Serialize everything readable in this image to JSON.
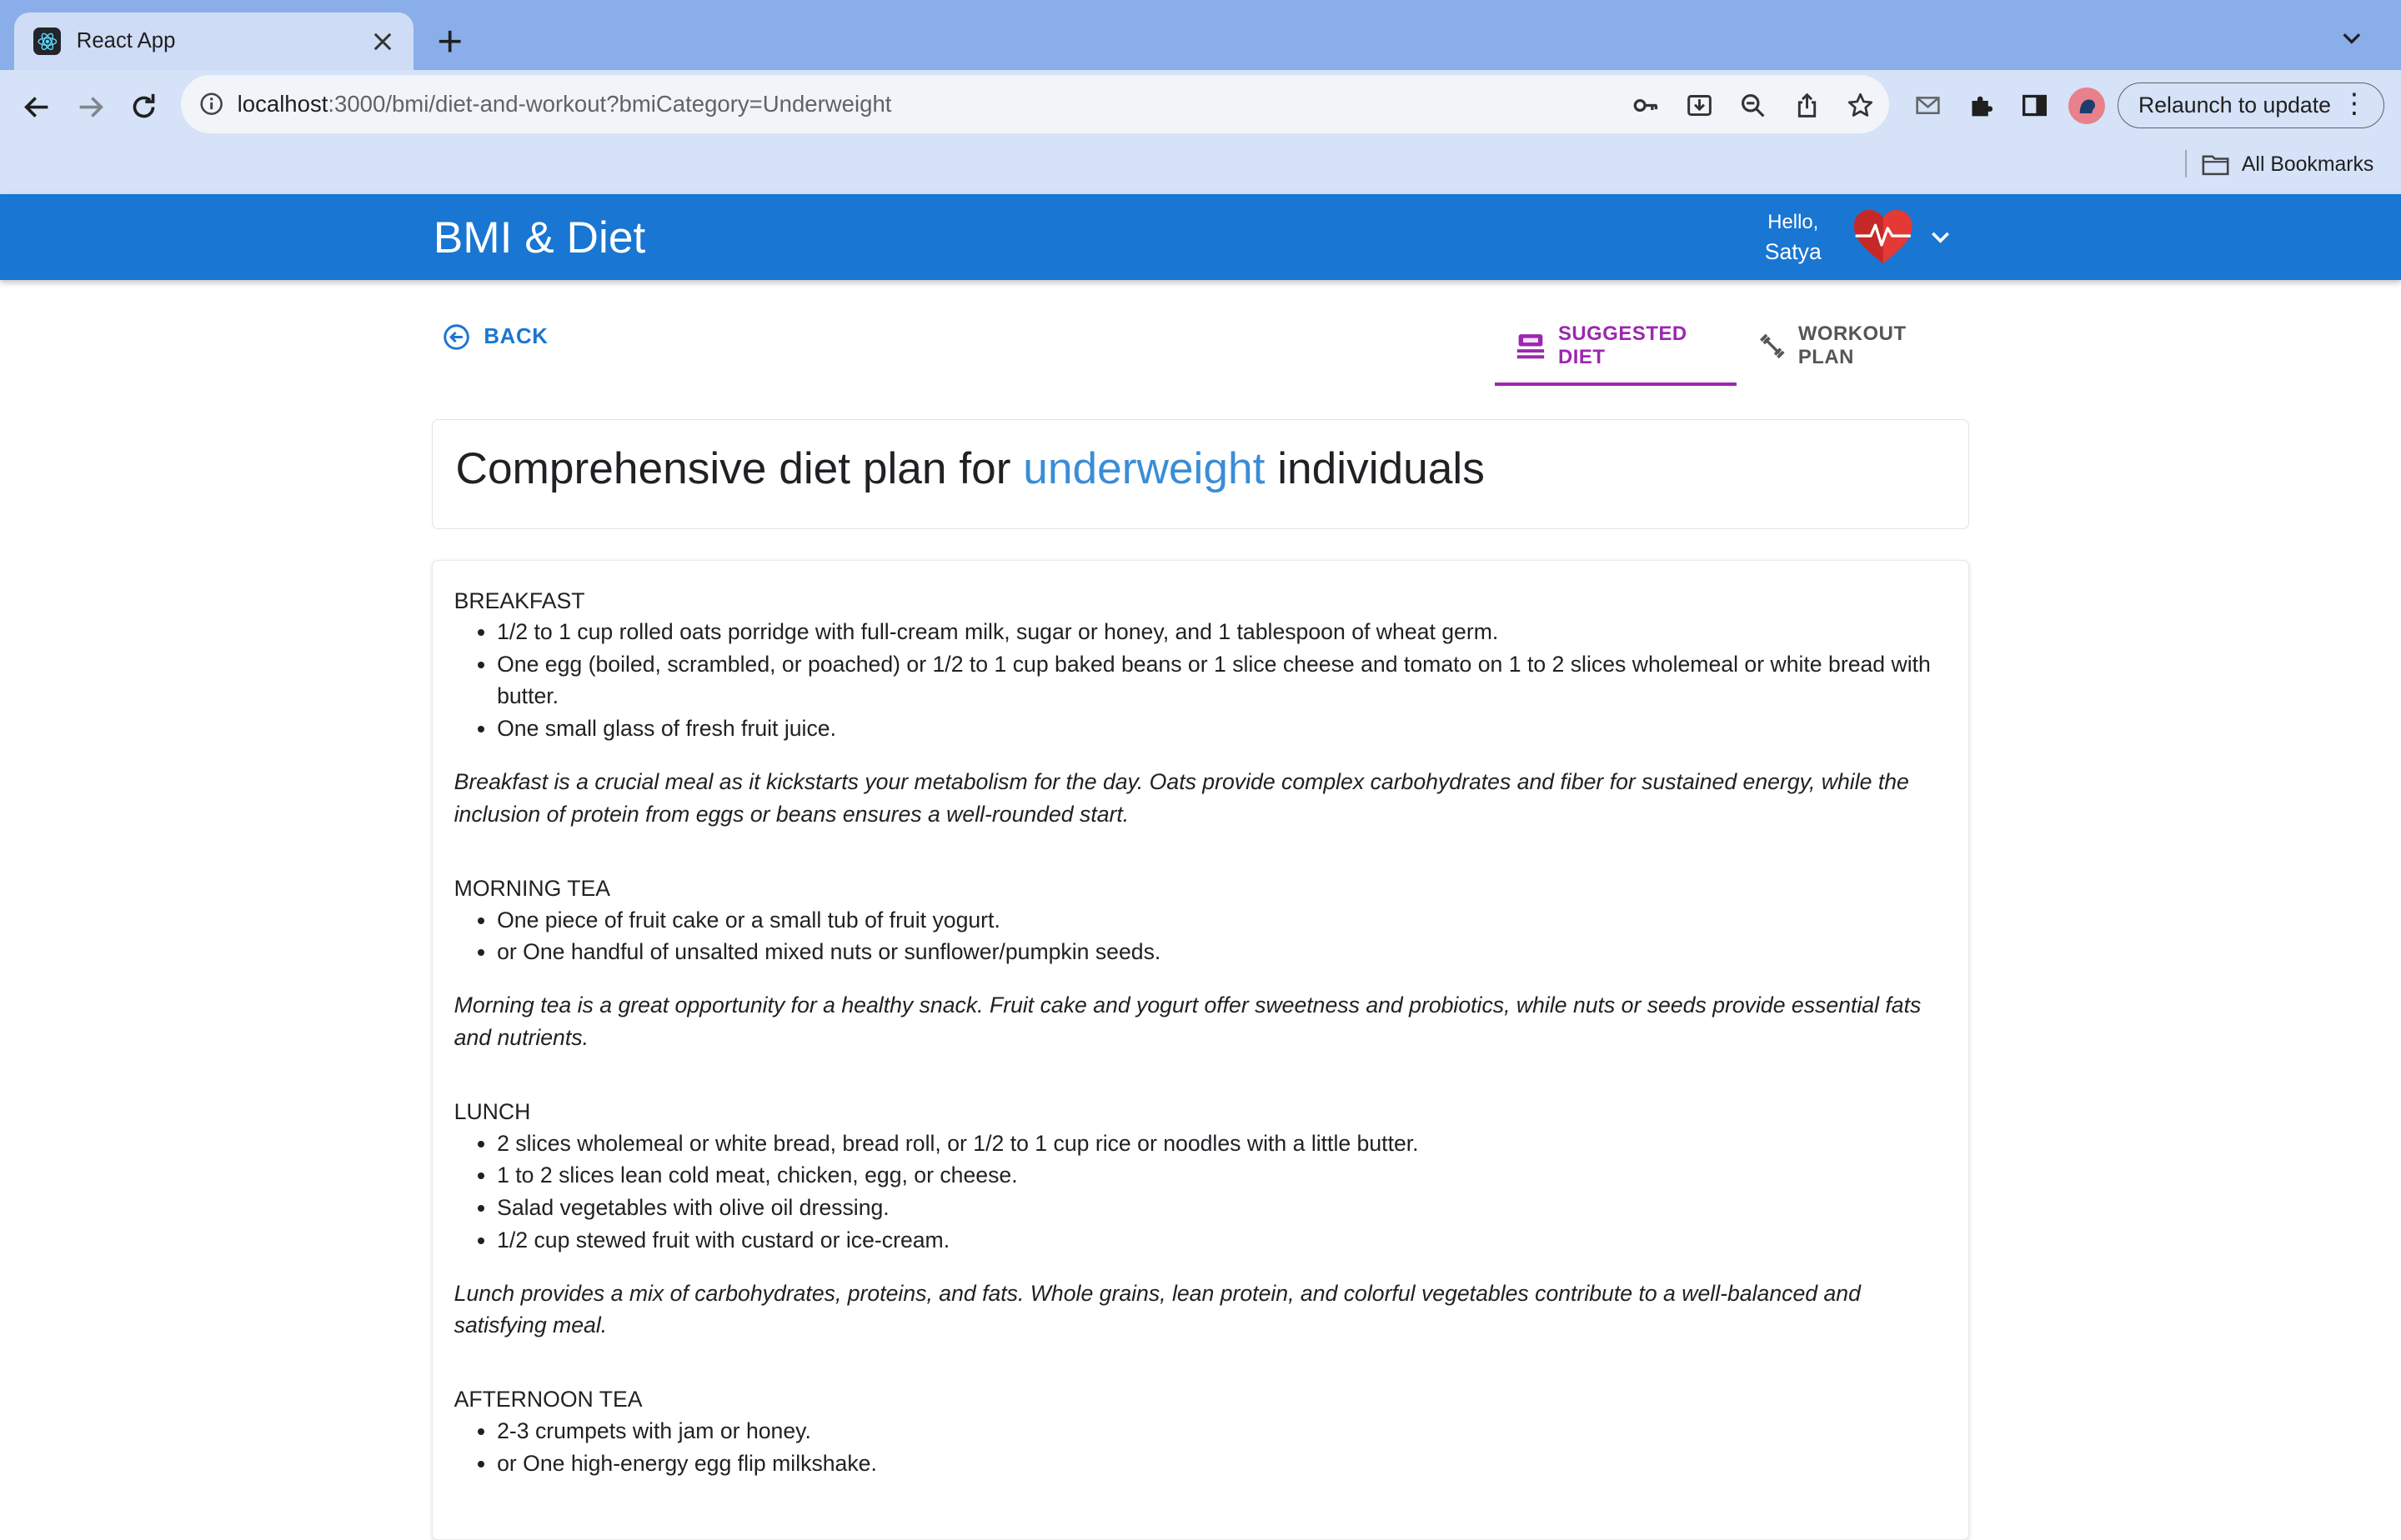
{
  "browser": {
    "tab_title": "React App",
    "url_host": "localhost",
    "url_rest": ":3000/bmi/diet-and-workout?bmiCategory=Underweight",
    "relaunch_label": "Relaunch to update",
    "bookmarks_label": "All Bookmarks"
  },
  "header": {
    "brand": "BMI & Diet",
    "greeting": "Hello,",
    "user_name": "Satya"
  },
  "nav": {
    "back_label": "BACK",
    "tabs": [
      {
        "label": "SUGGESTED DIET",
        "selected": true
      },
      {
        "label": "WORKOUT PLAN",
        "selected": false
      }
    ]
  },
  "colors": {
    "appbar": "#1976d2",
    "accent_tab": "#9c27b0",
    "highlight": "#3a8dd6"
  },
  "title": {
    "prefix": "Comprehensive diet plan for ",
    "highlight": "underweight",
    "suffix": " individuals"
  },
  "meals": [
    {
      "name": "BREAKFAST",
      "items": [
        "1/2 to 1 cup rolled oats porridge with full-cream milk, sugar or honey, and 1 tablespoon of wheat germ.",
        "One egg (boiled, scrambled, or poached) or 1/2 to 1 cup baked beans or 1 slice cheese and tomato on 1 to 2 slices wholemeal or white bread with butter.",
        "One small glass of fresh fruit juice."
      ],
      "description": "Breakfast is a crucial meal as it kickstarts your metabolism for the day. Oats provide complex carbohydrates and fiber for sustained energy, while the inclusion of protein from eggs or beans ensures a well-rounded start."
    },
    {
      "name": "MORNING TEA",
      "items": [
        "One piece of fruit cake or a small tub of fruit yogurt.",
        "or One handful of unsalted mixed nuts or sunflower/pumpkin seeds."
      ],
      "description": "Morning tea is a great opportunity for a healthy snack. Fruit cake and yogurt offer sweetness and probiotics, while nuts or seeds provide essential fats and nutrients."
    },
    {
      "name": "LUNCH",
      "items": [
        "2 slices wholemeal or white bread, bread roll, or 1/2 to 1 cup rice or noodles with a little butter.",
        "1 to 2 slices lean cold meat, chicken, egg, or cheese.",
        "Salad vegetables with olive oil dressing.",
        "1/2 cup stewed fruit with custard or ice-cream."
      ],
      "description": "Lunch provides a mix of carbohydrates, proteins, and fats. Whole grains, lean protein, and colorful vegetables contribute to a well-balanced and satisfying meal."
    },
    {
      "name": "AFTERNOON TEA",
      "items": [
        "2-3 crumpets with jam or honey.",
        "or One high-energy egg flip milkshake."
      ],
      "description": ""
    }
  ]
}
